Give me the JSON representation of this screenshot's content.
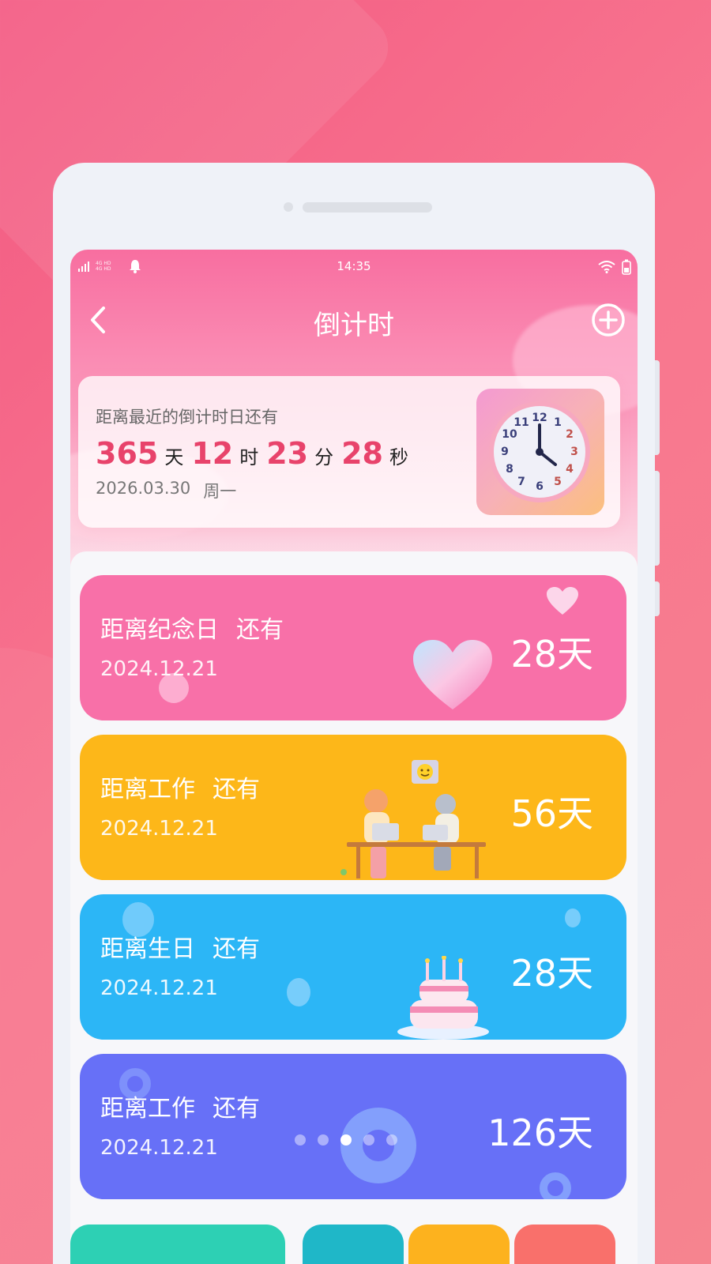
{
  "status_bar": {
    "time": "14:35",
    "signal_text": "4G  HD",
    "signal_text2": "4G  HD"
  },
  "nav": {
    "title": "倒计时"
  },
  "summary": {
    "label": "距离最近的倒计时日还有",
    "days": "365",
    "days_unit": "天",
    "hours": "12",
    "hours_unit": "时",
    "minutes": "23",
    "minutes_unit": "分",
    "seconds": "28",
    "seconds_unit": "秒",
    "date": "2026.03.30",
    "weekday": "周一"
  },
  "cards": [
    {
      "title": "距离纪念日",
      "suffix": "还有",
      "date": "2024.12.21",
      "days": "28天",
      "color": "#f870a8"
    },
    {
      "title": "距离工作",
      "suffix": "还有",
      "date": "2024.12.21",
      "days": "56天",
      "color": "#fdb719"
    },
    {
      "title": "距离生日",
      "suffix": "还有",
      "date": "2024.12.21",
      "days": "28天",
      "color": "#2cb6f6"
    },
    {
      "title": "距离工作",
      "suffix": "还有",
      "date": "2024.12.21",
      "days": "126天",
      "color": "#6770f7"
    }
  ],
  "pager": {
    "count": 5,
    "active_index": 2
  },
  "bottom_tiles": [
    {
      "color": "#2dd0b4"
    },
    {
      "color": "#1fb7c8"
    },
    {
      "color": "#fdb21e"
    },
    {
      "color": "#f9706b"
    }
  ]
}
